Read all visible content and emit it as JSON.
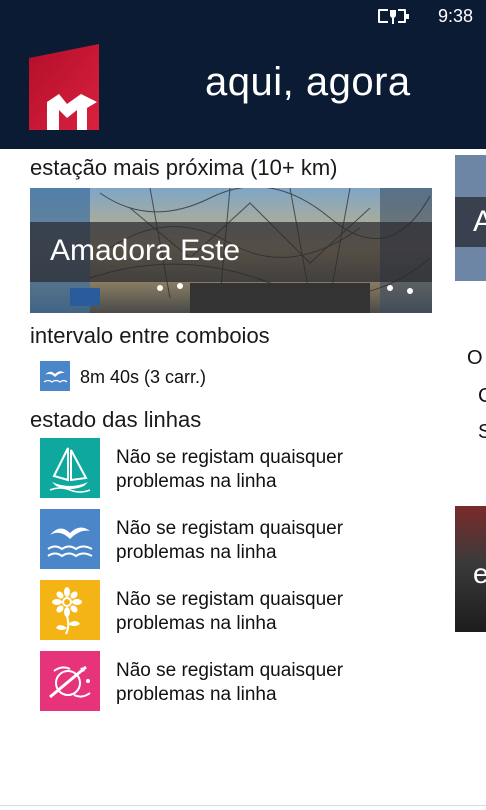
{
  "status_bar": {
    "time": "9:38",
    "icons": [
      "battery-charging-icon"
    ]
  },
  "header": {
    "title": "aqui, agora",
    "logo": "metro-logo-icon"
  },
  "nearest_station": {
    "label": "estação mais próxima (10+ km)",
    "name": "Amadora Este"
  },
  "train_interval": {
    "label": "intervalo entre comboios",
    "icon": "gull-line-icon",
    "value": "8m 40s (3 carr.)"
  },
  "line_status": {
    "label": "estado das linhas",
    "items": [
      {
        "line": "azul-marinho",
        "icon": "boat-line-icon",
        "color": "#0fa89e",
        "text": "Não se registam quaisquer problemas na linha"
      },
      {
        "line": "azul",
        "icon": "gull-line-icon",
        "color": "#4a86c8",
        "text": "Não se registam quaisquer problemas na linha"
      },
      {
        "line": "amarela",
        "icon": "sunflower-line-icon",
        "color": "#f5b416",
        "text": "Não se registam quaisquer problemas na linha"
      },
      {
        "line": "vermelha",
        "icon": "compass-line-icon",
        "color": "#e6337a",
        "text": "Não se registam quaisquer problemas na linha"
      }
    ]
  },
  "next_panel_peek": {
    "letters": [
      "A",
      "O",
      "C",
      "S",
      "e"
    ]
  },
  "colors": {
    "header_bg": "#0b1b33",
    "logo_red": "#c8102e"
  }
}
